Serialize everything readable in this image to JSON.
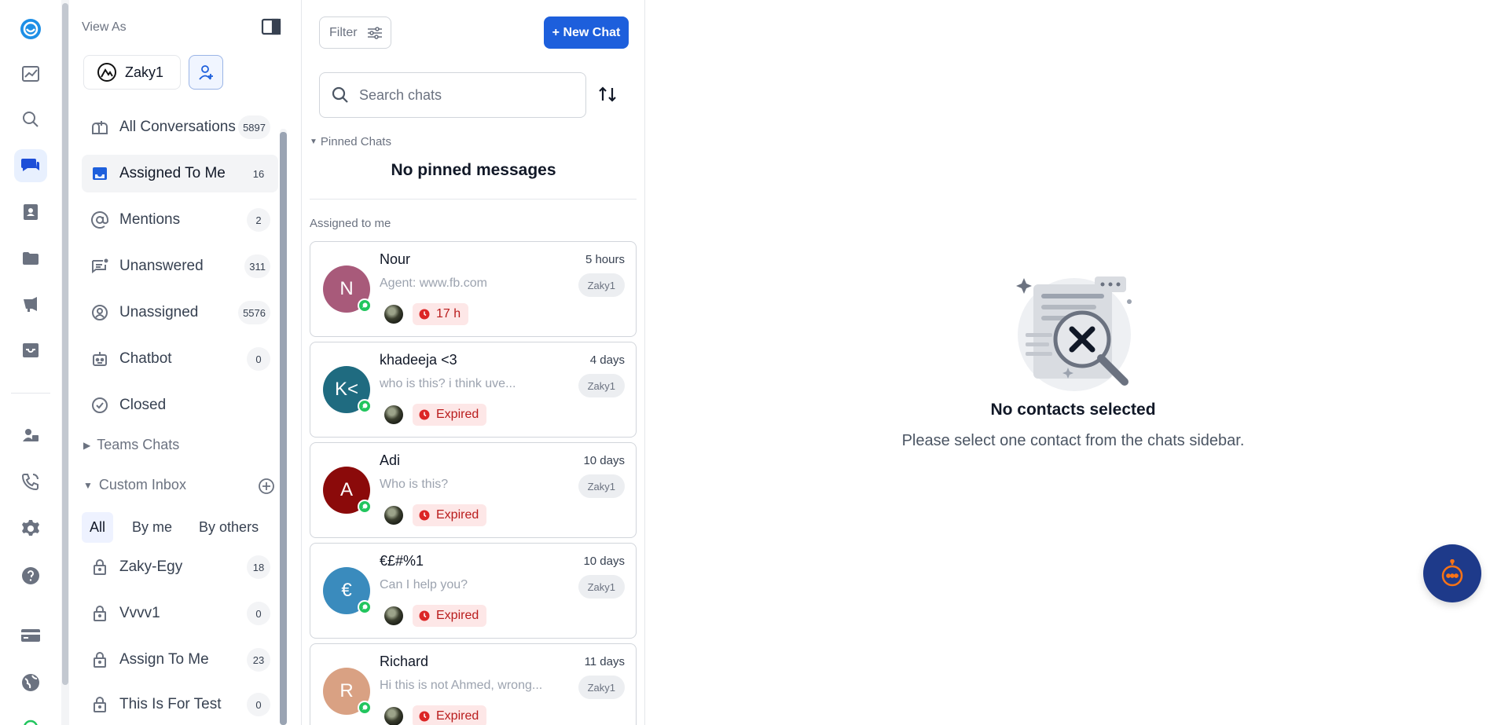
{
  "folders": {
    "view_as": "View As",
    "user": "Zaky1",
    "nav": [
      {
        "label": "All Conversations",
        "count": "5897",
        "icon": "mailbox-icon"
      },
      {
        "label": "Assigned To Me",
        "count": "16",
        "icon": "inbox-icon"
      },
      {
        "label": "Mentions",
        "count": "2",
        "icon": "at-icon"
      },
      {
        "label": "Unanswered",
        "count": "311",
        "icon": "message-alert-icon"
      },
      {
        "label": "Unassigned",
        "count": "5576",
        "icon": "user-circle-icon"
      },
      {
        "label": "Chatbot",
        "count": "0",
        "icon": "robot-icon"
      },
      {
        "label": "Closed",
        "count": "",
        "icon": "check-circle-icon"
      }
    ],
    "teams_chats": "Teams Chats",
    "custom_inbox": "Custom Inbox",
    "segments": [
      "All",
      "By me",
      "By others"
    ],
    "custom": [
      {
        "label": "Zaky-Egy",
        "count": "18"
      },
      {
        "label": "Vvvv1",
        "count": "0"
      },
      {
        "label": "Assign To Me",
        "count": "23"
      },
      {
        "label": "This Is For Test",
        "count": "0"
      }
    ]
  },
  "chatlist": {
    "filter": "Filter",
    "new_chat": "+ New Chat",
    "search_placeholder": "Search chats",
    "pinned_head": "Pinned Chats",
    "no_pinned": "No pinned messages",
    "assigned_head": "Assigned to me",
    "chats": [
      {
        "initials": "N",
        "name": "Nour",
        "time": "5 hours",
        "message": "Agent: www.fb.com",
        "agent": "Zaky1",
        "status": "17 h",
        "color": "#a85a7a"
      },
      {
        "initials": "K<",
        "name": "khadeeja <3",
        "time": "4 days",
        "message": "who is this? i think uve...",
        "agent": "Zaky1",
        "status": "Expired",
        "color": "#1f6b80"
      },
      {
        "initials": "A",
        "name": "Adi",
        "time": "10 days",
        "message": "Who is this?",
        "agent": "Zaky1",
        "status": "Expired",
        "color": "#8b0a0a"
      },
      {
        "initials": "€",
        "name": "€£#%1",
        "time": "10 days",
        "message": "Can I help you?",
        "agent": "Zaky1",
        "status": "Expired",
        "color": "#3a8bbd"
      },
      {
        "initials": "R",
        "name": "Richard",
        "time": "11 days",
        "message": "Hi this is not Ahmed, wrong...",
        "agent": "Zaky1",
        "status": "Expired",
        "color": "#d9a183"
      }
    ]
  },
  "main": {
    "empty_title": "No contacts selected",
    "empty_subtitle": "Please select one contact from the chats sidebar."
  },
  "colors": {
    "accent": "#1d5fdc",
    "expired_bg": "#fde7e7",
    "expired_fg": "#b91c1c",
    "fab": "#1e3a8a"
  }
}
